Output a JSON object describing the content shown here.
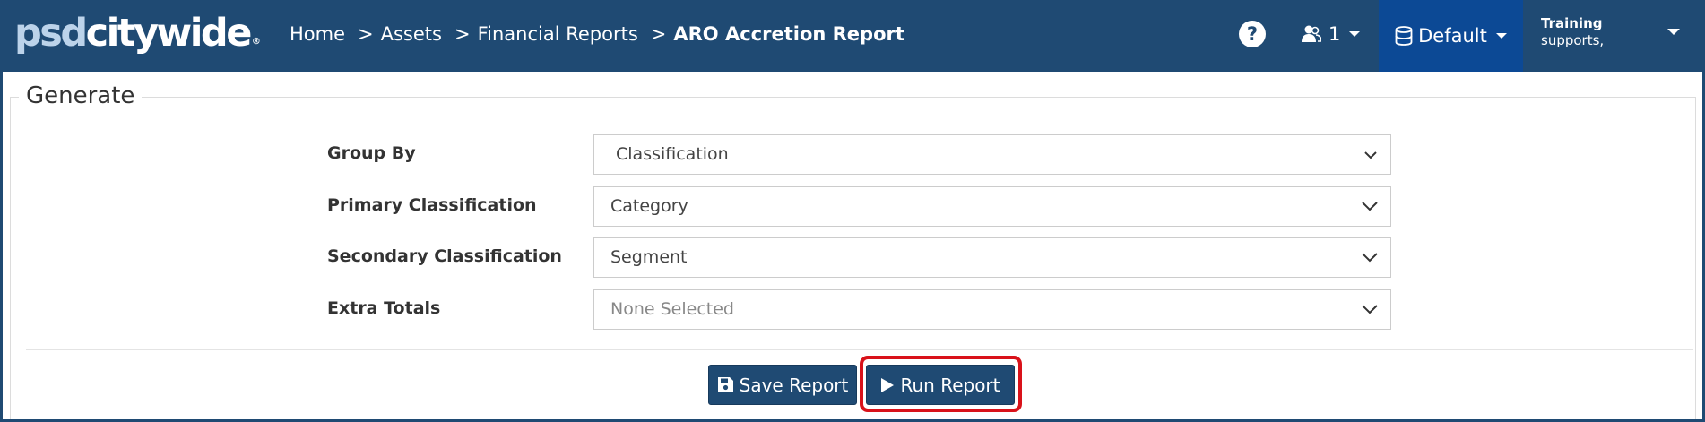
{
  "brand": {
    "part1": "psd",
    "part2": "citywide",
    "reg": "®"
  },
  "breadcrumb": {
    "items": [
      "Home",
      "Assets",
      "Financial Reports"
    ],
    "current": "ARO Accretion Report",
    "separator": ">"
  },
  "header": {
    "help_label": "?",
    "user_count": "1",
    "database_label": "Default",
    "account_name": "Training",
    "account_sub": "supports,"
  },
  "form": {
    "legend": "Generate",
    "rows": [
      {
        "label": "Group By",
        "value": "Classification"
      },
      {
        "label": "Primary Classification",
        "value": "Category"
      },
      {
        "label": "Secondary Classification",
        "value": "Segment"
      },
      {
        "label": "Extra Totals",
        "placeholder": "None Selected"
      }
    ]
  },
  "actions": {
    "save_label": "Save Report",
    "run_label": "Run Report"
  },
  "colors": {
    "navbar": "#1f4a73",
    "db_menu": "#0c4995",
    "button": "#1f4a73",
    "highlight": "#d9121a"
  },
  "icons": {
    "help": "question-circle-icon",
    "user": "users-icon",
    "database": "database-icon",
    "save": "floppy-disk-icon",
    "run": "play-icon"
  }
}
